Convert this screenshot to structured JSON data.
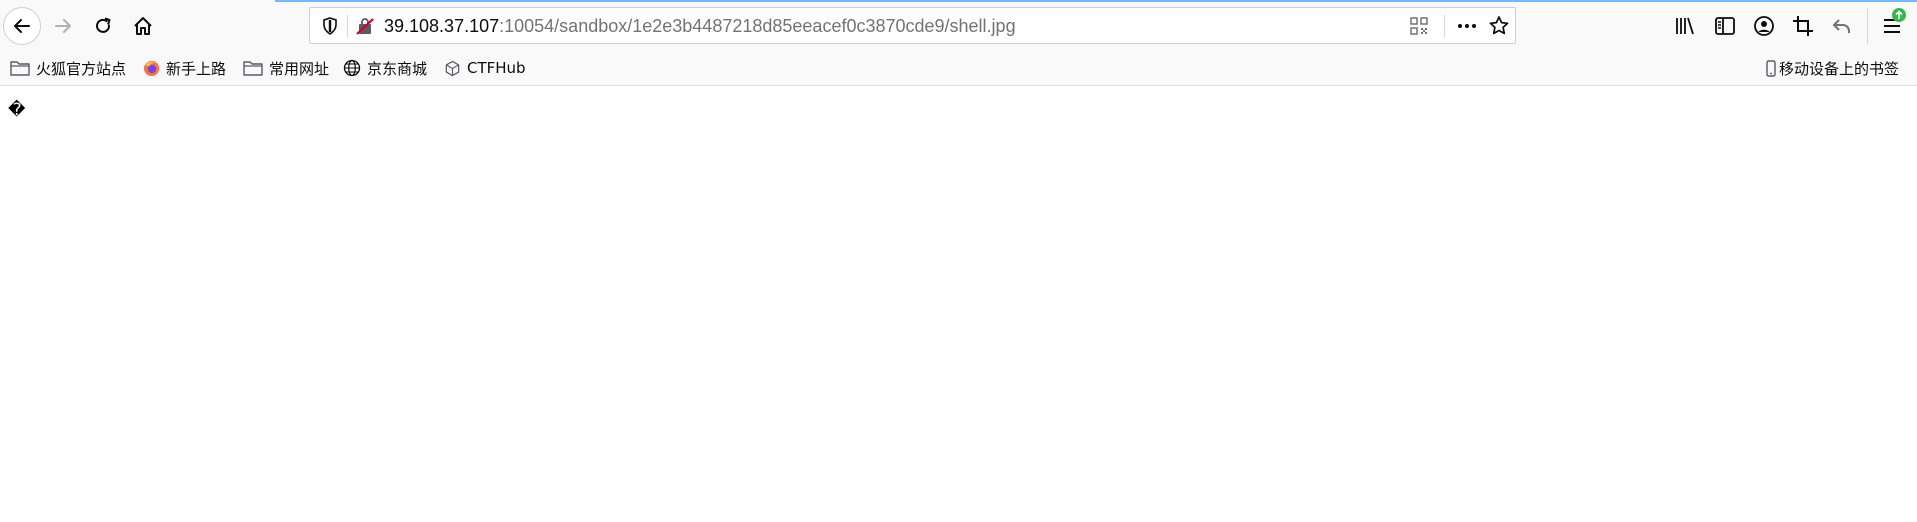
{
  "toolbar": {
    "url_host": "39.108.37.107",
    "url_rest": ":10054/sandbox/1e2e3b4487218d85eeacef0c3870cde9/shell.jpg",
    "icons": [
      "back-icon",
      "forward-icon",
      "reload-icon",
      "home-icon",
      "tracking-shield-icon",
      "insecure-connection-icon",
      "qr-code-icon",
      "page-actions-icon",
      "bookmark-star-icon",
      "library-icon",
      "sidebar-icon",
      "account-icon",
      "screenshot-crop-icon",
      "undo-icon",
      "menu-icon"
    ],
    "accent_color": "#0a84ff",
    "update_badge_color": "#35b84a"
  },
  "bookmarks": {
    "items": [
      {
        "label": "火狐官方站点",
        "icon": "folder-icon"
      },
      {
        "label": "新手上路",
        "icon": "firefox-icon"
      },
      {
        "label": "常用网址",
        "icon": "folder-icon"
      },
      {
        "label": "京东商城",
        "icon": "globe-icon"
      },
      {
        "label": "CTFHub",
        "icon": "cube-icon"
      }
    ],
    "mobile_label": "移动设备上的书签"
  },
  "content": {
    "text": "�"
  }
}
